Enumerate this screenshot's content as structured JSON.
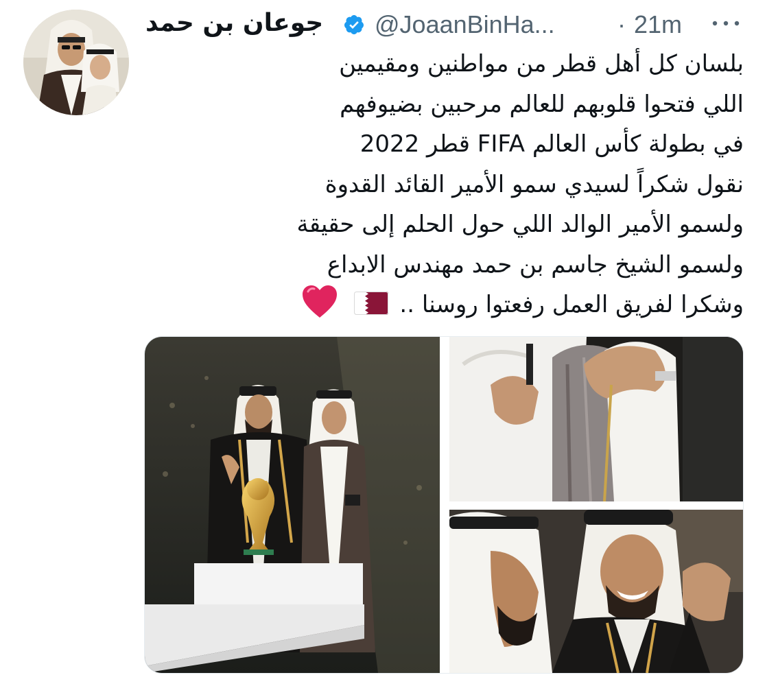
{
  "tweet": {
    "author": {
      "display_name": "جوعان بن حمد",
      "handle": "@JoaanBinHa...",
      "verified": true,
      "avatar_icon": "profile-photo"
    },
    "separator": "·",
    "timestamp": "21m",
    "more_icon": "more-horizontal-icon",
    "text_lines": [
      "بلسان كل أهل قطر من مواطنين ومقيمين",
      "اللي فتحوا قلوبهم للعالم مرحبين بضيوفهم",
      "في بطولة كأس العالم FIFA قطر 2022",
      "نقول شكراً لسيدي سمو الأمير القائد القدوة",
      "ولسمو الأمير الوالد اللي حول الحلم إلى حقيقة",
      "ولسمو الشيخ جاسم بن حمد مهندس الابداع"
    ],
    "last_line_text": "وشكرا لفريق العمل رفعتوا روسنا ..",
    "emojis": [
      "qatar-flag",
      "red-heart"
    ],
    "media": [
      {
        "name": "photo-world-cup-trophy",
        "description_icon": "photo"
      },
      {
        "name": "photo-embrace",
        "description_icon": "photo"
      },
      {
        "name": "photo-celebration",
        "description_icon": "photo"
      }
    ]
  },
  "colors": {
    "text_primary": "#0f1419",
    "text_secondary": "#536471",
    "verified_blue": "#1d9bf0",
    "qatar_maroon": "#8a1538",
    "heart_red": "#e0245e"
  }
}
